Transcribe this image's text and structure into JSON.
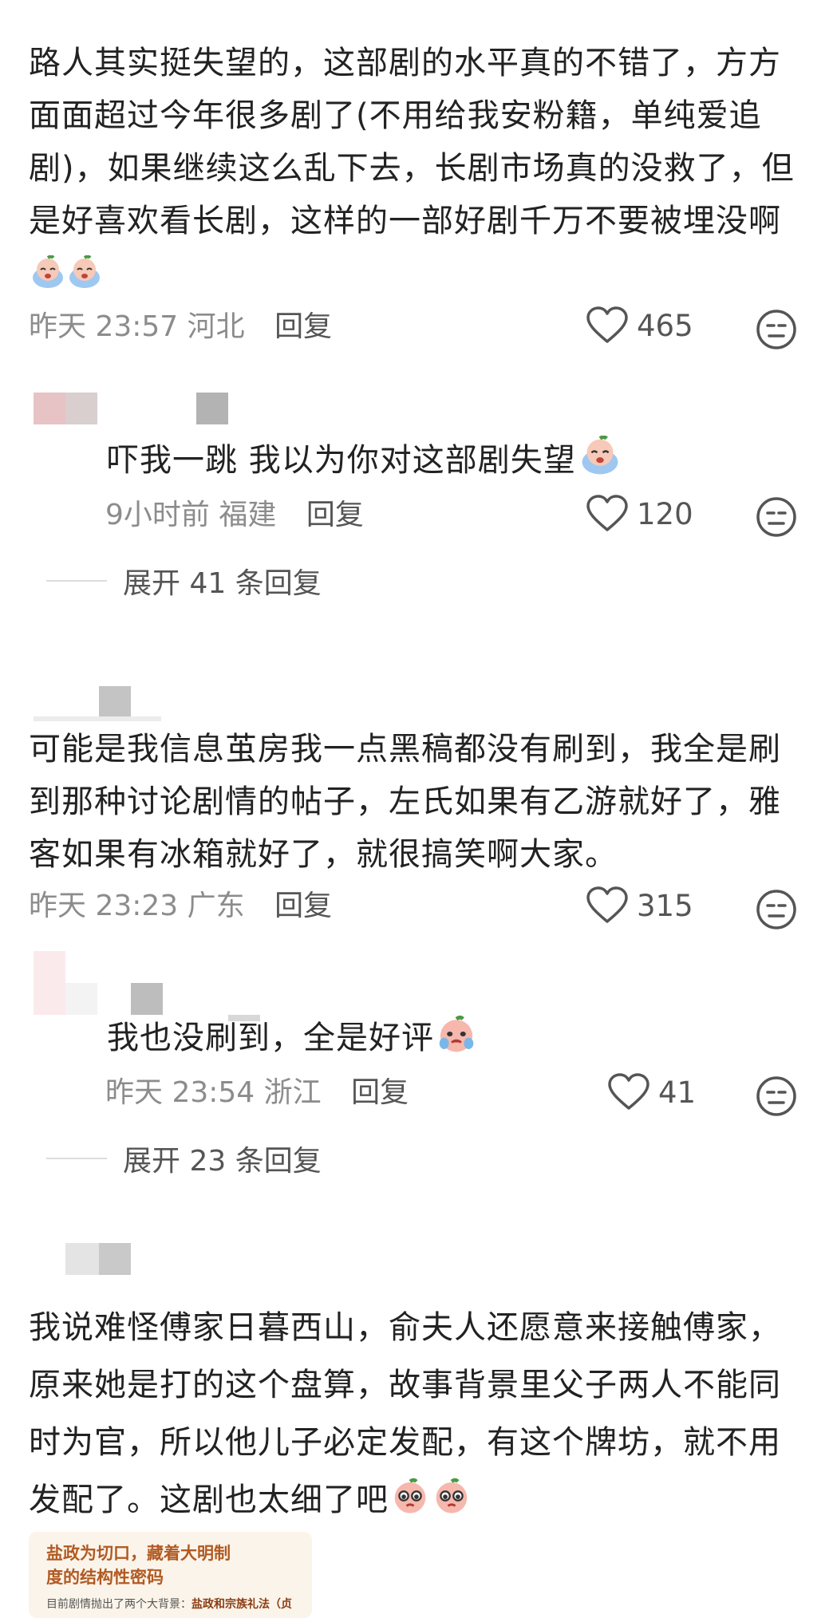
{
  "comments": [
    {
      "text": "路人其实挺失望的，这部剧的水平真的不错了，方方面面超过今年很多剧了(不用给我安粉籍，单纯爱追剧)，如果继续这么乱下去，长剧市场真的没救了，但是好喜欢看长剧，这样的一部好剧千万不要被埋没啊",
      "emojis": [
        "crying-emoji",
        "crying-emoji"
      ],
      "time": "昨天 23:57",
      "location": "河北",
      "reply_label": "回复",
      "likes": "465"
    },
    {
      "text": "吓我一跳 我以为你对这部剧失望",
      "emojis": [
        "crying-emoji"
      ],
      "time": "9小时前",
      "location": "福建",
      "reply_label": "回复",
      "likes": "120"
    },
    {
      "text": "可能是我信息茧房我一点黑稿都没有刷到，我全是刷到那种讨论剧情的帖子，左氏如果有乙游就好了，雅客如果有冰箱就好了，就很搞笑啊大家。",
      "time": "昨天 23:23",
      "location": "广东",
      "reply_label": "回复",
      "likes": "315"
    },
    {
      "text": "我也没刷到，全是好评",
      "emojis": [
        "teary-emoji"
      ],
      "time": "昨天 23:54",
      "location": "浙江",
      "reply_label": "回复",
      "likes": "41"
    },
    {
      "text": "我说难怪傅家日暮西山，俞夫人还愿意来接触傅家，原来她是打的这个盘算，故事背景里父子两人不能同时为官，所以他儿子必定发配，有这个牌坊，就不用发配了。这剧也太细了吧",
      "emojis": [
        "pleading-emoji",
        "pleading-emoji"
      ]
    }
  ],
  "expand_replies": [
    {
      "label": "展开 41 条回复"
    },
    {
      "label": "展开 23 条回复"
    }
  ],
  "image_card": {
    "title": "盐政为切口，藏着大明制度的结构性密码",
    "sub_prefix": "目前剧情抛出了两个大背景：",
    "sub_bold": "盐政和宗族礼法（贞"
  },
  "colors": {
    "text": "#222222",
    "meta": "#8c8c8c",
    "accent_card": "#b15a22"
  }
}
